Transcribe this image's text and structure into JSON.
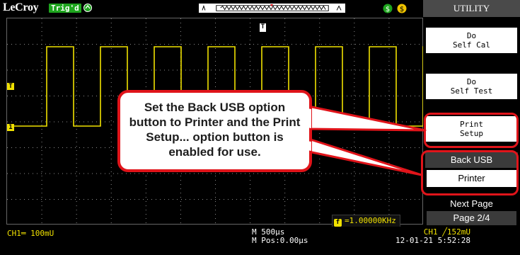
{
  "header": {
    "brand": "LeCroy",
    "trigger_status": "Trig'd"
  },
  "menu": {
    "title": "UTILITY",
    "do_self_cal": [
      "Do",
      "Self Cal"
    ],
    "do_self_test": [
      "Do",
      "Self Test"
    ],
    "print_setup": [
      "Print",
      "Setup"
    ],
    "back_usb_label": "Back USB",
    "back_usb_value": "Printer",
    "next_page_label": "Next Page",
    "next_page_value": "Page 2/4"
  },
  "screen": {
    "trigger_marker": "T",
    "trigger_level_marker": "T",
    "ch1_marker": "1",
    "frequency": "=1.00000KHz",
    "frequency_icon": "f"
  },
  "status_bar": {
    "ch1_scale": "CH1═ 100mU",
    "timebase": "M 500μs",
    "position": "M Pos:0.00μs",
    "trigger_info": "CH1 ╱152mU",
    "datetime": "12-01-21 5:52:28"
  },
  "callout": {
    "text": "Set the Back USB option button to Printer and the Print Setup... option button is enabled for use."
  },
  "colors": {
    "trace": "#f0e100",
    "highlight": "#e0141a",
    "trig_badge": "#1ea51e",
    "grid": "#8c8c8c"
  }
}
